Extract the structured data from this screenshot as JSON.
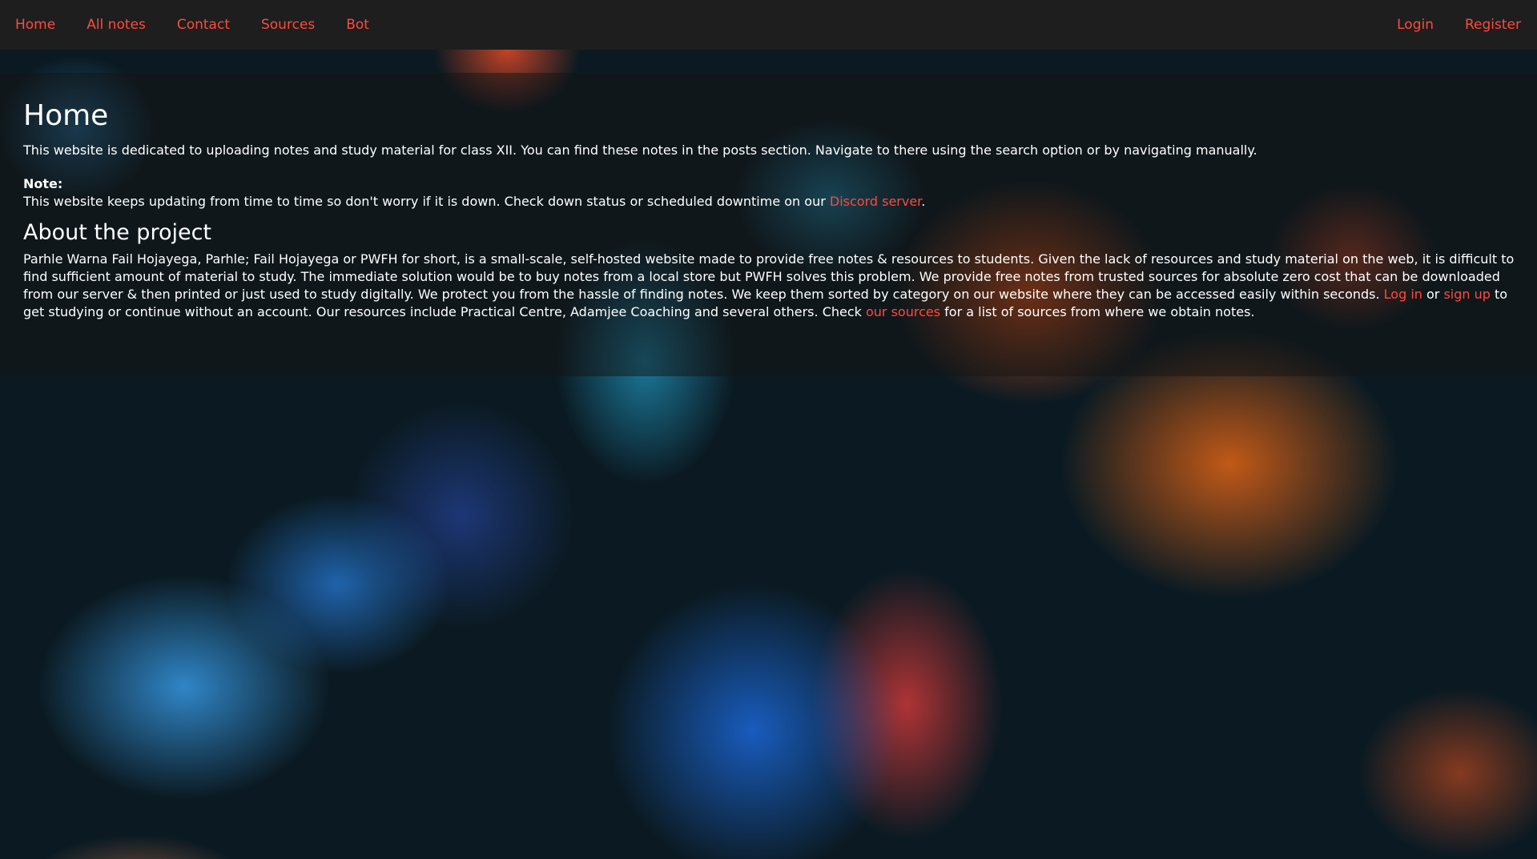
{
  "nav": {
    "home": "Home",
    "all_notes": "All notes",
    "contact": "Contact",
    "sources": "Sources",
    "bot": "Bot",
    "login": "Login",
    "register": "Register"
  },
  "page": {
    "title": "Home",
    "intro": "This website is dedicated to uploading notes and study material for class XII. You can find these notes in the posts section. Navigate to there using the search option or by navigating manually.",
    "note_label": "Note:",
    "note_text": "This website keeps updating from time to time so don't worry if it is down. Check down status or scheduled downtime on our ",
    "discord_link": "Discord server",
    "note_end": "."
  },
  "about": {
    "title": "About the project",
    "text_1": "Parhle Warna Fail Hojayega, Parhle; Fail Hojayega or PWFH for short, is a small-scale, self-hosted website made to provide free notes & resources to students. Given the lack of resources and study material on the web, it is difficult to find sufficient amount of material to study. The immediate solution would be to buy notes from a local store but PWFH solves this problem. We provide free notes from trusted sources for absolute zero cost that can be downloaded from our server & then printed or just used to study digitally. We protect you from the hassle of finding notes. We keep them sorted by category on our website where they can be accessed easily within seconds. ",
    "login_link": "Log in",
    "or": " or ",
    "signup_link": "sign up",
    "text_2": " to get studying or continue without an account. Our resources include Practical Centre, Adamjee Coaching and several others. Check ",
    "sources_link": "our sources",
    "text_3": " for a list of sources from where we obtain notes."
  },
  "colors": {
    "accent": "#ff4a3d",
    "navbar_bg": "#1e1e1e",
    "text": "#ffffff"
  }
}
